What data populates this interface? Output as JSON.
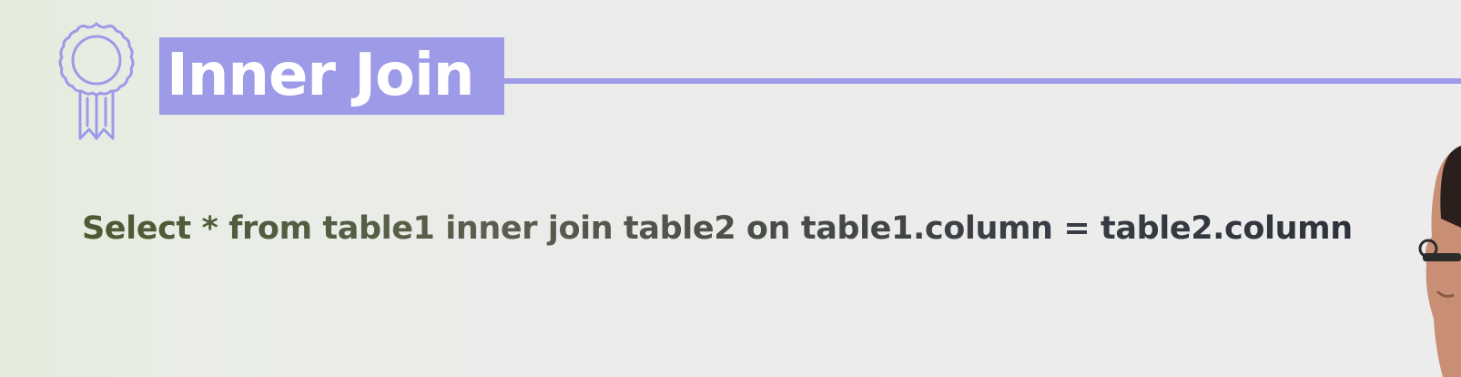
{
  "slide": {
    "title": "Inner Join",
    "query": "Select * from table1 inner join table2 on table1.column = table2.column"
  },
  "icons": {
    "badge": "award-ribbon-icon"
  },
  "colors": {
    "accent": "#9d9ae8",
    "title_text": "#ffffff",
    "body_text": "#3a3e45",
    "background": "#ececec"
  }
}
